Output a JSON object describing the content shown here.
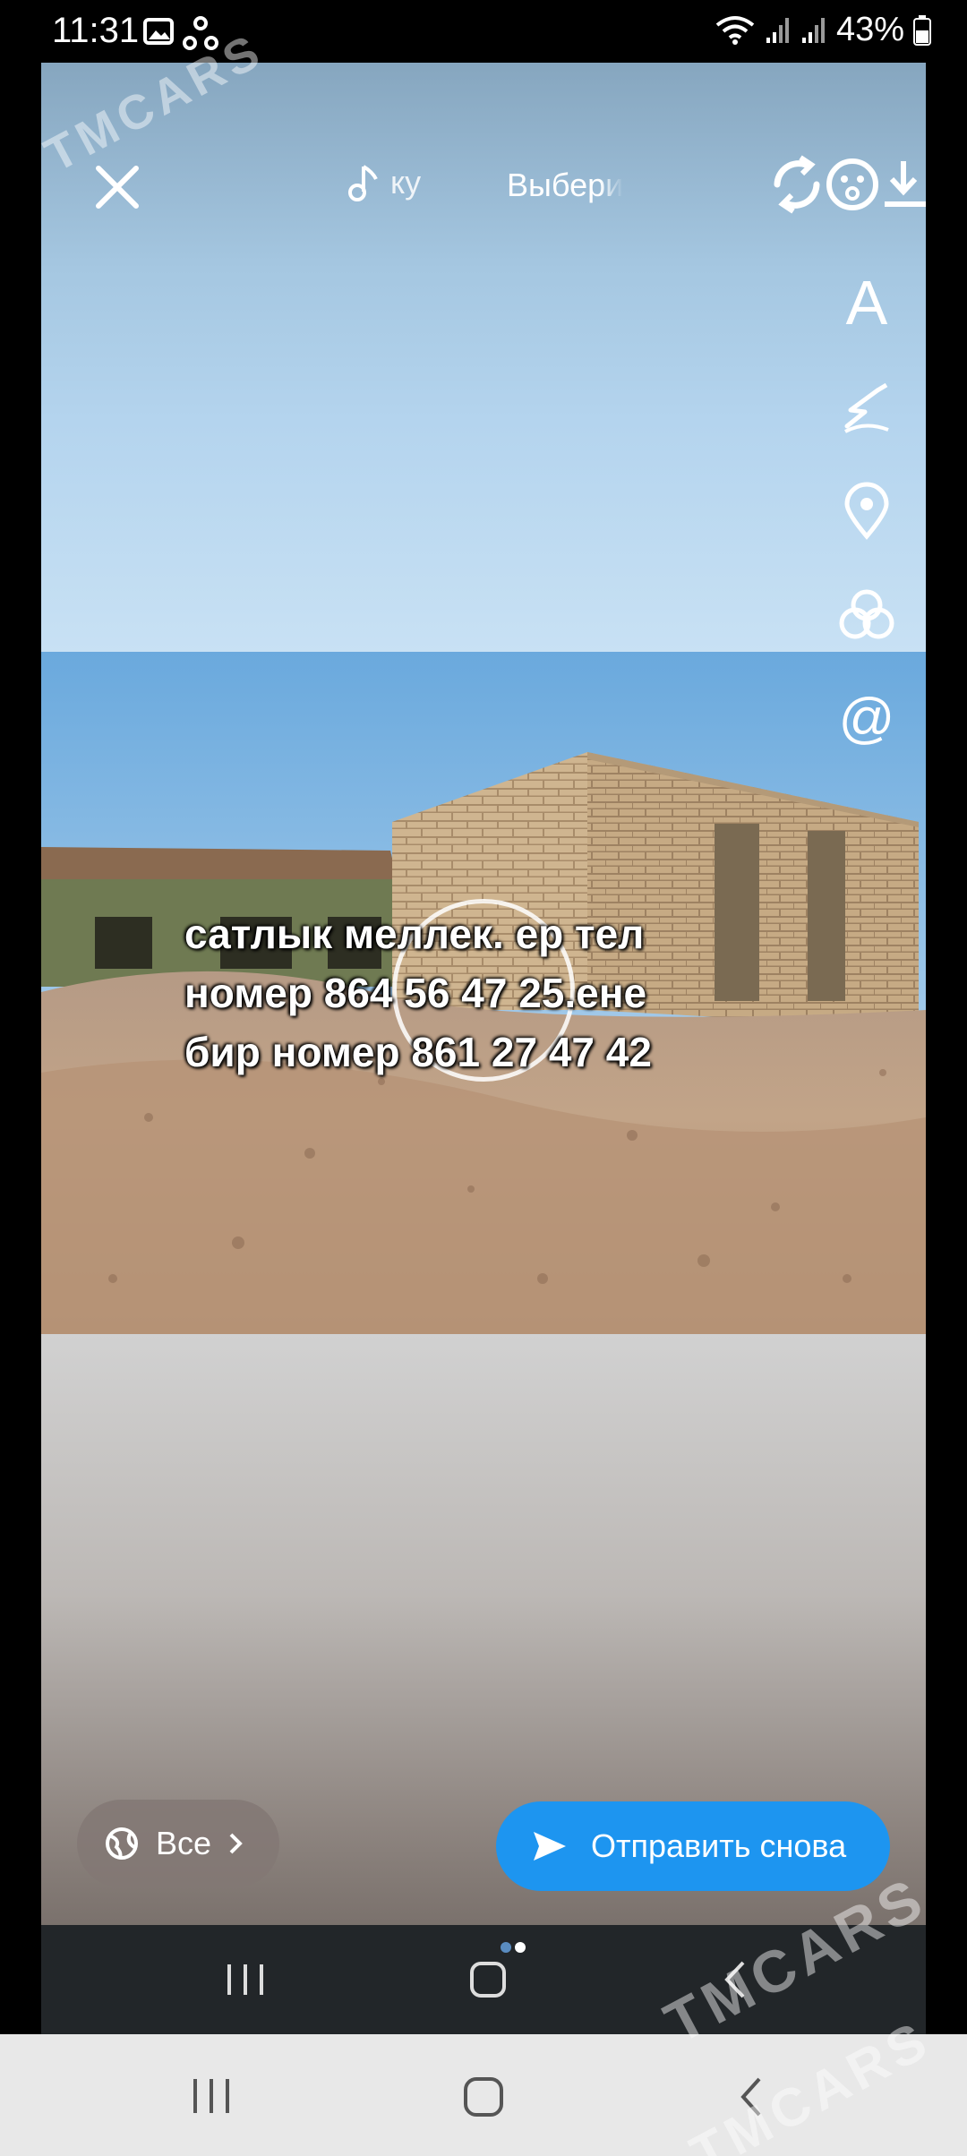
{
  "status_bar": {
    "time": "11:31",
    "battery": "43%",
    "icons": [
      "gallery-icon",
      "share-icon",
      "wifi-icon",
      "signal-icon",
      "signal-icon",
      "battery-icon"
    ]
  },
  "top_bar": {
    "music_label": "ку",
    "choose_label": "Выбери",
    "icons": [
      "close-icon",
      "music-note-icon",
      "flip-camera-icon",
      "sticker-icon",
      "download-icon"
    ]
  },
  "side_tools": [
    "text-tool-icon",
    "draw-tool-icon",
    "location-icon",
    "effects-icon",
    "mention-icon"
  ],
  "side_text_glyph": "A",
  "mention_glyph": "@",
  "caption": {
    "line1": "сатлык меллек. ер тел",
    "line2": "номер 864 56 47 25.ене",
    "line3": "бир номер 861 27 47 42"
  },
  "bottom": {
    "all_label": "Все",
    "resend_label": "Отправить снова"
  },
  "watermark": "TMCARS",
  "colors": {
    "accent_blue": "#1d95f0",
    "nav_dark": "#222629",
    "nav_light": "#e8e8e8"
  }
}
